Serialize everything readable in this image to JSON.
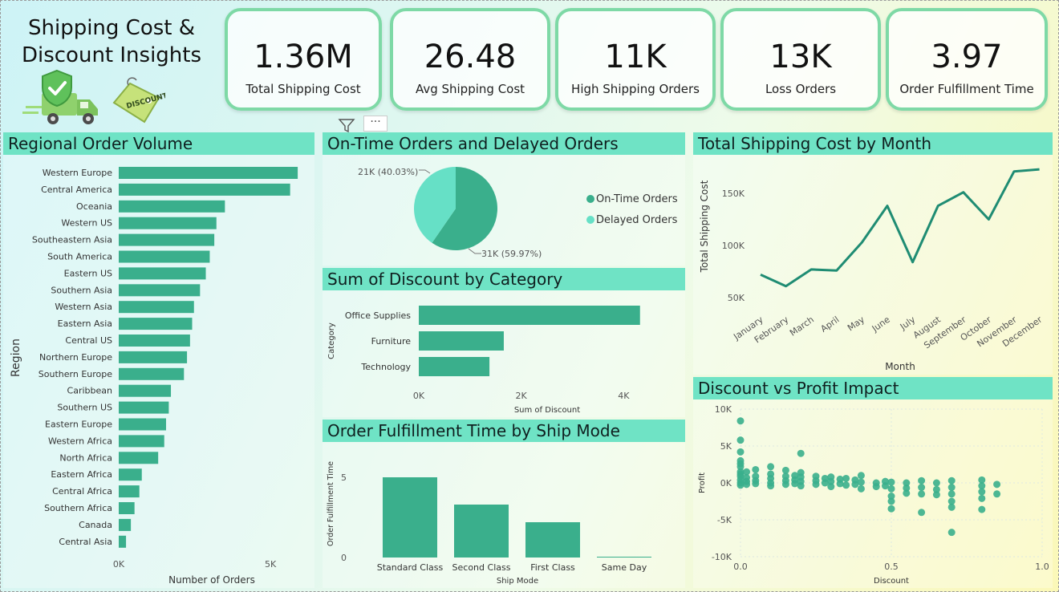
{
  "title": "Shipping Cost &\nDiscount Insights",
  "logo_badge_text": "DISCOUNT",
  "kpis": [
    {
      "value": "1.36M",
      "label": "Total Shipping Cost"
    },
    {
      "value": "26.48",
      "label": "Avg Shipping Cost"
    },
    {
      "value": "11K",
      "label": "High Shipping Orders"
    },
    {
      "value": "13K",
      "label": "Loss Orders"
    },
    {
      "value": "3.97",
      "label": "Order Fulfillment Time"
    }
  ],
  "toolbar": {
    "more_label": "···"
  },
  "colors": {
    "series": "#3aaf8c",
    "series_light": "#66e0c6",
    "header_band": "#6fe3c5",
    "kpi_border": "#7ed9a6"
  },
  "icons": [
    "filter-icon",
    "more-options-icon",
    "shield-check-icon",
    "delivery-truck-icon",
    "discount-tag-icon"
  ],
  "chart_data": [
    {
      "type": "bar",
      "title": "Regional Order Volume",
      "orientation": "horizontal",
      "xlabel": "Number of Orders",
      "ylabel": "Region",
      "xlim": [
        0,
        6400
      ],
      "x_ticks": [
        "0K",
        "5K"
      ],
      "categories": [
        "Western Europe",
        "Central America",
        "Oceania",
        "Western US",
        "Southeastern Asia",
        "South America",
        "Eastern US",
        "Southern Asia",
        "Western Asia",
        "Eastern Asia",
        "Central US",
        "Northern Europe",
        "Southern Europe",
        "Caribbean",
        "Southern US",
        "Eastern Europe",
        "Western Africa",
        "North Africa",
        "Eastern Africa",
        "Central Africa",
        "Southern Africa",
        "Canada",
        "Central Asia"
      ],
      "values": [
        5900,
        5650,
        3500,
        3220,
        3150,
        3000,
        2870,
        2680,
        2480,
        2420,
        2350,
        2250,
        2150,
        1720,
        1650,
        1560,
        1500,
        1300,
        760,
        680,
        520,
        400,
        240
      ]
    },
    {
      "type": "pie",
      "title": "On-Time Orders and Delayed Orders",
      "series": [
        {
          "name": "On-Time Orders",
          "value": 31,
          "label": "31K (59.97%)",
          "color": "#3aaf8c"
        },
        {
          "name": "Delayed Orders",
          "value": 21,
          "label": "21K (40.03%)",
          "color": "#66e0c6"
        }
      ]
    },
    {
      "type": "bar",
      "title": "Sum of Discount by Category",
      "orientation": "horizontal",
      "xlabel": "Sum of Discount",
      "ylabel": "Category",
      "xlim": [
        0,
        4700
      ],
      "x_ticks": [
        "0K",
        "2K",
        "4K"
      ],
      "categories": [
        "Office Supplies",
        "Furniture",
        "Technology"
      ],
      "values": [
        4320,
        1660,
        1380
      ]
    },
    {
      "type": "bar",
      "title": "Order Fulfillment Time by Ship Mode",
      "xlabel": "Ship Mode",
      "ylabel": "Order Fulfillment Time",
      "ylim": [
        0,
        6
      ],
      "y_ticks": [
        "0",
        "5"
      ],
      "categories": [
        "Standard Class",
        "Second Class",
        "First Class",
        "Same Day"
      ],
      "values": [
        5.0,
        3.3,
        2.2,
        0.05
      ]
    },
    {
      "type": "line",
      "title": "Total Shipping Cost by Month",
      "xlabel": "Month",
      "ylabel": "Total Shipping Cost",
      "ylim": [
        40000,
        180000
      ],
      "y_ticks": [
        "50K",
        "100K",
        "150K"
      ],
      "categories": [
        "January",
        "February",
        "March",
        "April",
        "May",
        "June",
        "July",
        "August",
        "September",
        "October",
        "November",
        "December"
      ],
      "values": [
        72000,
        61000,
        77000,
        76000,
        103000,
        138000,
        84000,
        138000,
        151000,
        125000,
        171000,
        173000
      ]
    },
    {
      "type": "scatter",
      "title": "Discount vs Profit Impact",
      "xlabel": "Discount",
      "ylabel": "Profit",
      "xlim": [
        0,
        1
      ],
      "ylim": [
        -10000,
        10000
      ],
      "x_ticks": [
        "0.0",
        "0.5",
        "1.0"
      ],
      "y_ticks": [
        "10K",
        "5K",
        "0K",
        "-5K",
        "-10K"
      ],
      "points": [
        [
          0.0,
          8400
        ],
        [
          0.0,
          5800
        ],
        [
          0.0,
          4200
        ],
        [
          0.0,
          3000
        ],
        [
          0.0,
          2200
        ],
        [
          0.0,
          1500
        ],
        [
          0.0,
          900
        ],
        [
          0.0,
          400
        ],
        [
          0.0,
          0
        ],
        [
          0.0,
          -300
        ],
        [
          0.0,
          1200
        ],
        [
          0.0,
          2600
        ],
        [
          0.02,
          1500
        ],
        [
          0.02,
          700
        ],
        [
          0.02,
          200
        ],
        [
          0.02,
          -200
        ],
        [
          0.05,
          1800
        ],
        [
          0.05,
          900
        ],
        [
          0.05,
          300
        ],
        [
          0.05,
          -100
        ],
        [
          0.1,
          2200
        ],
        [
          0.1,
          1200
        ],
        [
          0.1,
          600
        ],
        [
          0.1,
          0
        ],
        [
          0.1,
          -400
        ],
        [
          0.15,
          1700
        ],
        [
          0.15,
          900
        ],
        [
          0.15,
          300
        ],
        [
          0.15,
          -200
        ],
        [
          0.18,
          1000
        ],
        [
          0.18,
          400
        ],
        [
          0.18,
          -100
        ],
        [
          0.2,
          4000
        ],
        [
          0.2,
          1400
        ],
        [
          0.2,
          800
        ],
        [
          0.2,
          200
        ],
        [
          0.2,
          -400
        ],
        [
          0.25,
          900
        ],
        [
          0.25,
          300
        ],
        [
          0.25,
          -200
        ],
        [
          0.28,
          600
        ],
        [
          0.28,
          0
        ],
        [
          0.3,
          800
        ],
        [
          0.3,
          200
        ],
        [
          0.3,
          -500
        ],
        [
          0.33,
          500
        ],
        [
          0.33,
          -100
        ],
        [
          0.35,
          600
        ],
        [
          0.35,
          -300
        ],
        [
          0.38,
          400
        ],
        [
          0.38,
          -200
        ],
        [
          0.4,
          1000
        ],
        [
          0.4,
          100
        ],
        [
          0.4,
          -800
        ],
        [
          0.45,
          0
        ],
        [
          0.45,
          -500
        ],
        [
          0.48,
          200
        ],
        [
          0.48,
          -400
        ],
        [
          0.5,
          100
        ],
        [
          0.5,
          -800
        ],
        [
          0.5,
          -1800
        ],
        [
          0.5,
          -2500
        ],
        [
          0.5,
          -3500
        ],
        [
          0.55,
          0
        ],
        [
          0.55,
          -700
        ],
        [
          0.55,
          -1400
        ],
        [
          0.6,
          300
        ],
        [
          0.6,
          -600
        ],
        [
          0.6,
          -1500
        ],
        [
          0.6,
          -4000
        ],
        [
          0.65,
          0
        ],
        [
          0.65,
          -900
        ],
        [
          0.65,
          -1600
        ],
        [
          0.7,
          300
        ],
        [
          0.7,
          -600
        ],
        [
          0.7,
          -1500
        ],
        [
          0.7,
          -2500
        ],
        [
          0.7,
          -3300
        ],
        [
          0.7,
          -6700
        ],
        [
          0.8,
          400
        ],
        [
          0.8,
          -400
        ],
        [
          0.8,
          -1200
        ],
        [
          0.8,
          -2100
        ],
        [
          0.8,
          -3600
        ],
        [
          0.85,
          -200
        ],
        [
          0.85,
          -1500
        ]
      ]
    }
  ]
}
